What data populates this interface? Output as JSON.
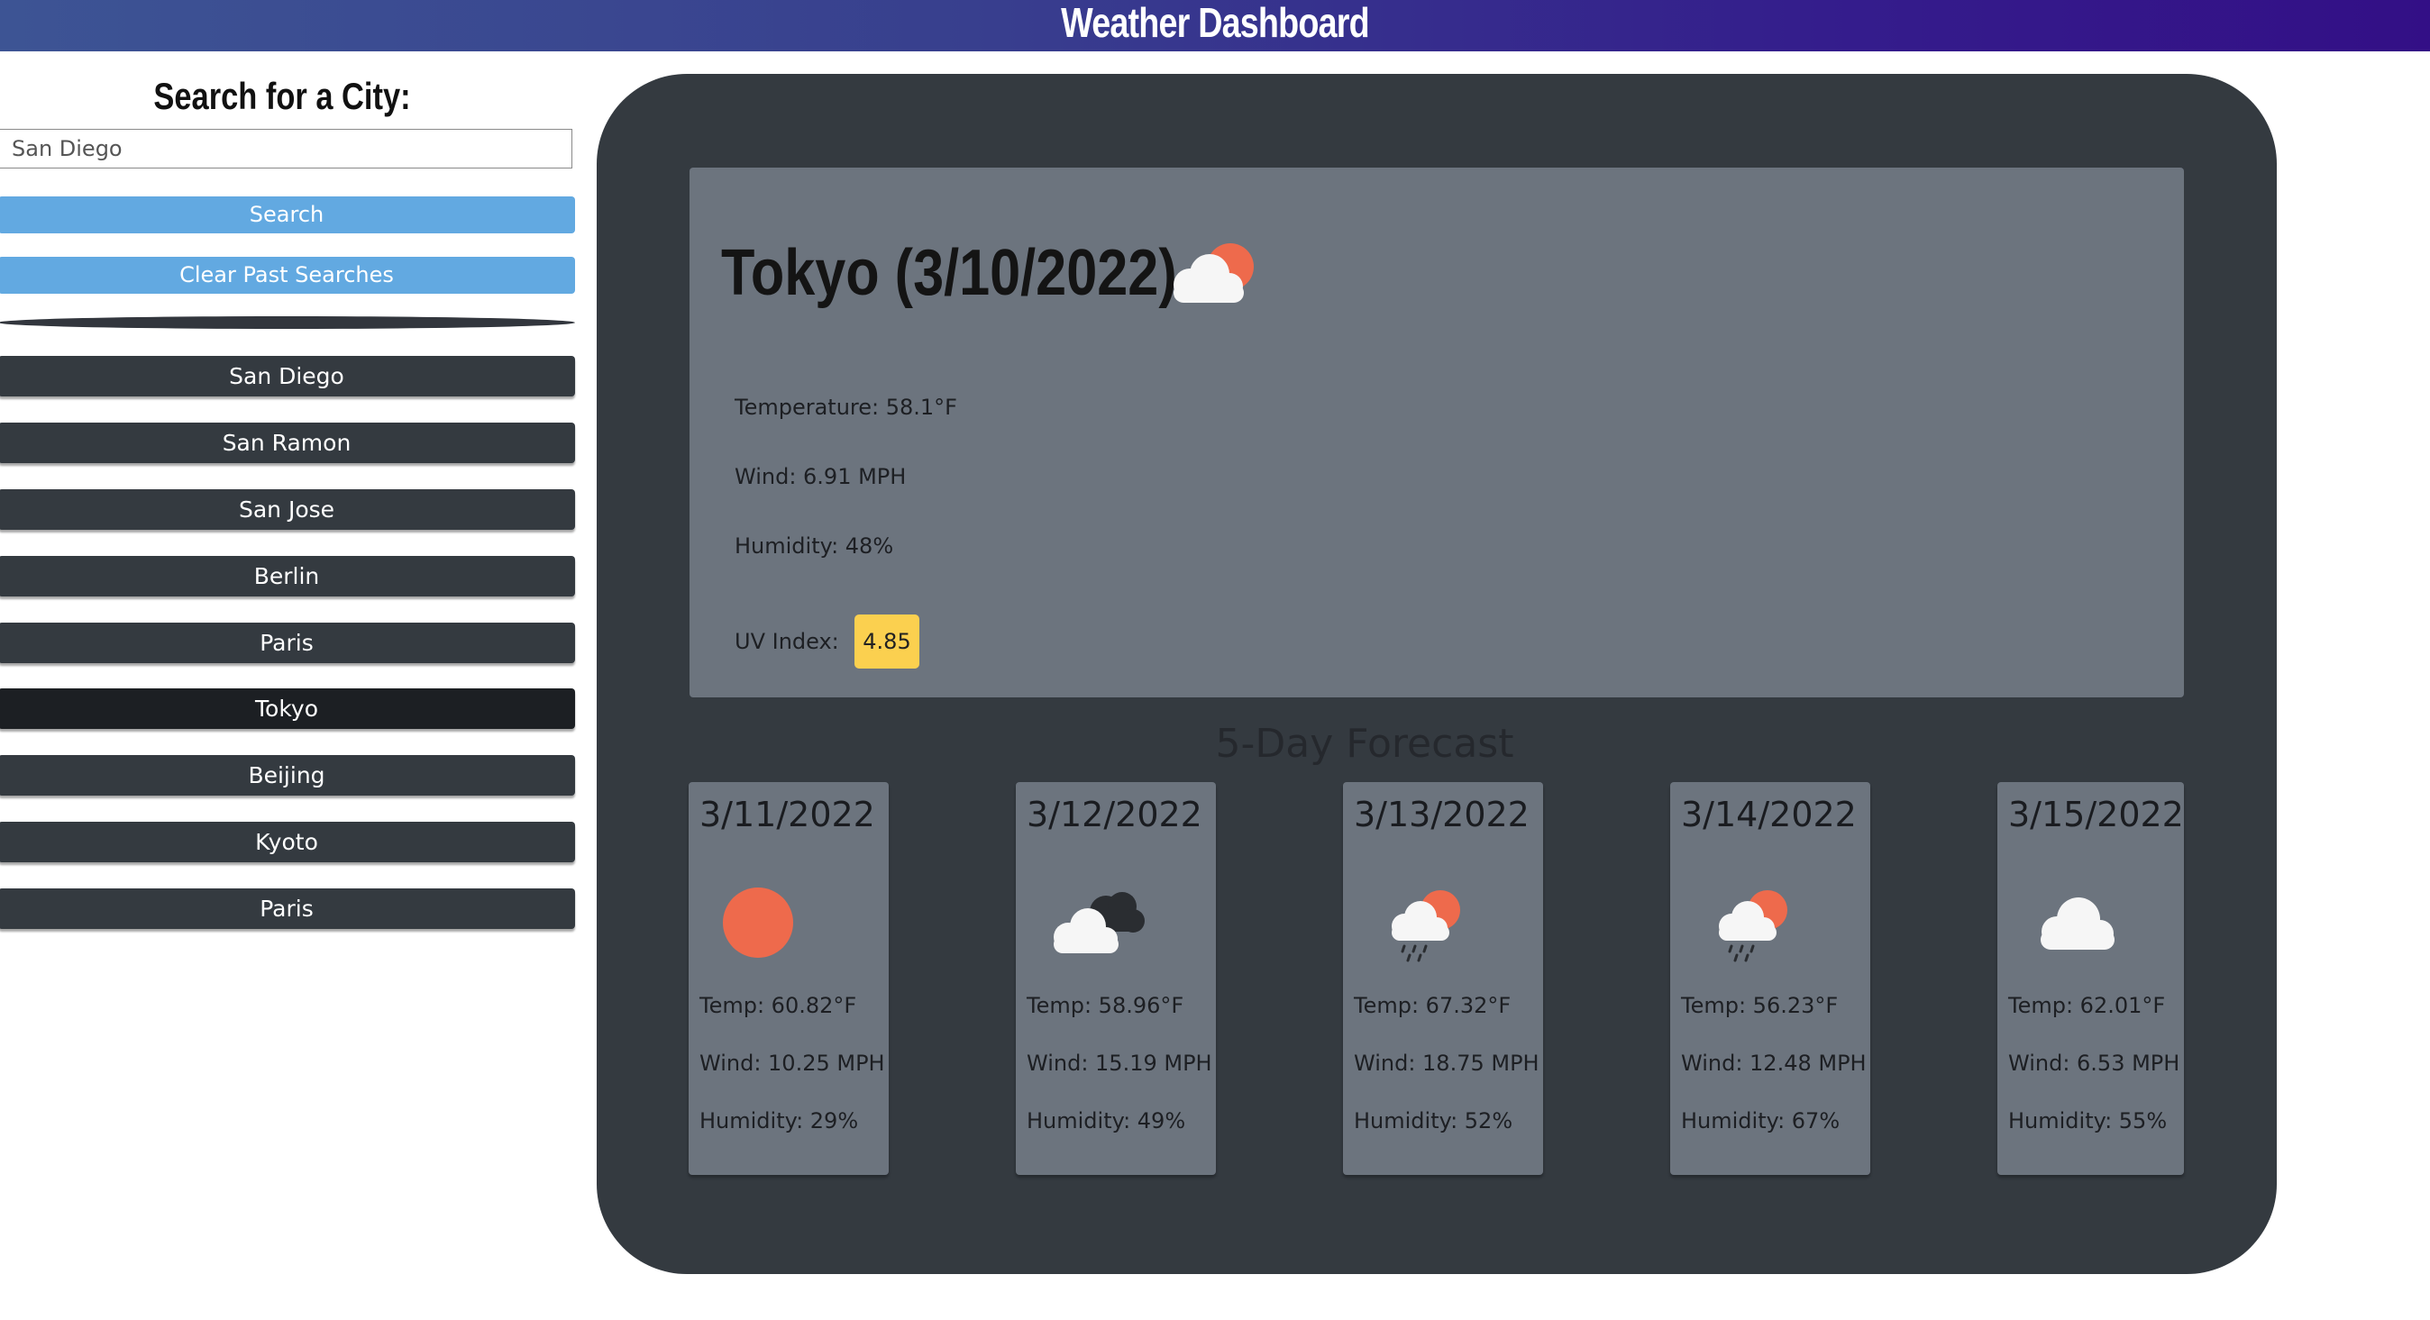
{
  "header": {
    "title": "Weather Dashboard"
  },
  "sidebar": {
    "heading": "Search for a City:",
    "search_value": "San Diego",
    "search_button": "Search",
    "clear_button": "Clear Past Searches",
    "history": [
      "San Diego",
      "San Ramon",
      "San Jose",
      "Berlin",
      "Paris",
      "Tokyo",
      "Beijing",
      "Kyoto",
      "Paris"
    ]
  },
  "current": {
    "title": "Tokyo (3/10/2022)",
    "icon": "partly-cloudy-icon",
    "temperature": "Temperature: 58.1°F",
    "wind": "Wind: 6.91 MPH",
    "humidity": "Humidity: 48%",
    "uv_label": "UV Index:",
    "uv_value": "4.85",
    "uv_color": "#fbd04f"
  },
  "forecast": {
    "title": "5-Day Forecast",
    "days": [
      {
        "date": "3/11/2022",
        "icon": "sun-icon",
        "temp": "Temp: 60.82°F",
        "wind": "Wind: 10.25 MPH",
        "humidity": "Humidity: 29%"
      },
      {
        "date": "3/12/2022",
        "icon": "overcast-clouds-icon",
        "temp": "Temp: 58.96°F",
        "wind": "Wind: 15.19 MPH",
        "humidity": "Humidity: 49%"
      },
      {
        "date": "3/13/2022",
        "icon": "sun-rain-icon",
        "temp": "Temp: 67.32°F",
        "wind": "Wind: 18.75 MPH",
        "humidity": "Humidity: 52%"
      },
      {
        "date": "3/14/2022",
        "icon": "sun-rain-icon",
        "temp": "Temp: 56.23°F",
        "wind": "Wind: 12.48 MPH",
        "humidity": "Humidity: 67%"
      },
      {
        "date": "3/15/2022",
        "icon": "cloud-icon",
        "temp": "Temp: 62.01°F",
        "wind": "Wind: 6.53 MPH",
        "humidity": "Humidity: 55%"
      }
    ]
  },
  "colors": {
    "header_start": "#3d5494",
    "header_end": "#330f86",
    "panel": "#343a40",
    "card": "#6c747e",
    "button_blue": "#62a9e1",
    "sun": "#ee6a4c"
  }
}
